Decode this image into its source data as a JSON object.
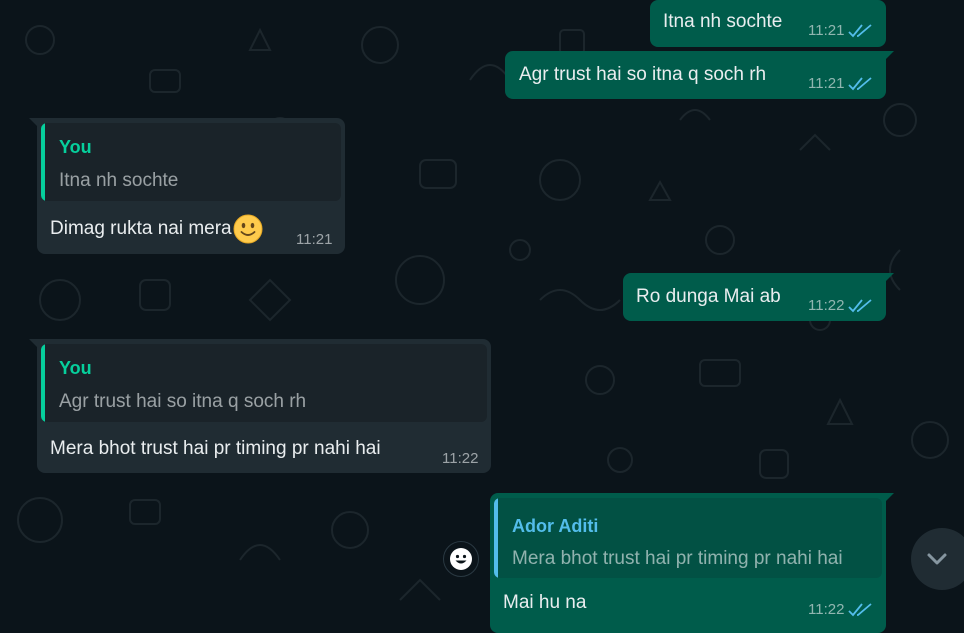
{
  "colors": {
    "background": "#0b141a",
    "outgoing_bubble": "#005c4b",
    "incoming_bubble": "#202c33",
    "quote_you": "#06cf9c",
    "quote_contact": "#53bdeb",
    "read_ticks": "#53bdeb"
  },
  "messages": [
    {
      "text": "Itna nh sochte",
      "time": "11:21",
      "status": "read"
    },
    {
      "text": "Agr trust hai so itna q soch rh",
      "time": "11:21",
      "status": "read"
    },
    {
      "quote_author": "You",
      "quote_text": "Itna nh sochte",
      "text": "Dimag rukta nai mera",
      "emoji": "slightly-smiling-face",
      "time": "11:21"
    },
    {
      "text": "Ro dunga Mai ab",
      "time": "11:22",
      "status": "read"
    },
    {
      "quote_author": "You",
      "quote_text": "Agr trust hai so itna q soch rh",
      "text": "Mera bhot trust hai pr timing pr nahi hai",
      "time": "11:22"
    },
    {
      "quote_author": "Ador Aditi",
      "quote_text": "Mera bhot trust hai pr timing pr nahi hai",
      "text": "Mai hu na",
      "time": "11:22",
      "status": "read"
    }
  ],
  "icons": {
    "react": "smiley-react-icon",
    "scroll": "chevron-down-icon",
    "ticks": "double-check-icon"
  }
}
